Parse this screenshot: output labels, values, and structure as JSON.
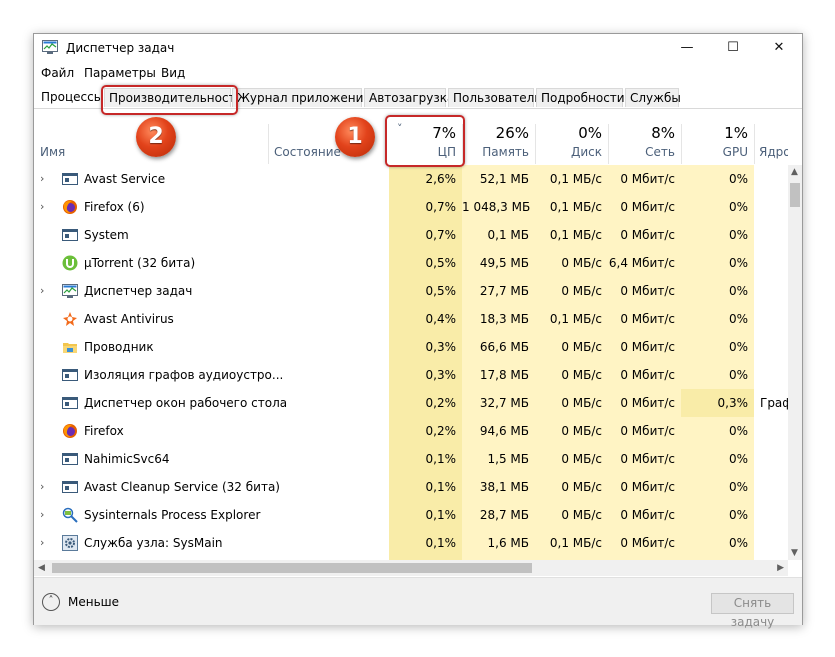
{
  "window": {
    "title": "Диспетчер задач",
    "controls": {
      "minimize": "—",
      "maximize": "☐",
      "close": "✕"
    }
  },
  "menu": {
    "file": "Файл",
    "params": "Параметры",
    "view": "Вид"
  },
  "tabs": [
    "Процессы",
    "Производительность",
    "Журнал приложений",
    "Автозагрузка",
    "Пользователи",
    "Подробности",
    "Службы"
  ],
  "columns": {
    "name": "Имя",
    "status": "Состояние",
    "cpu": {
      "label": "ЦП",
      "total": "7%"
    },
    "memory": {
      "label": "Память",
      "total": "26%"
    },
    "disk": {
      "label": "Диск",
      "total": "0%"
    },
    "network": {
      "label": "Сеть",
      "total": "8%"
    },
    "gpu": {
      "label": "GPU",
      "total": "1%"
    },
    "gpu_engine": {
      "label": "Ядро GP"
    }
  },
  "rows": [
    {
      "name": "Avast Service",
      "icon": "service-window-icon",
      "expandable": true,
      "cpu": "2,6%",
      "memory": "52,1 МБ",
      "disk": "0,1 МБ/с",
      "network": "0 Мбит/с",
      "gpu": "0%",
      "gpu_engine": ""
    },
    {
      "name": "Firefox (6)",
      "icon": "firefox-icon",
      "expandable": true,
      "cpu": "0,7%",
      "memory": "1 048,3 МБ",
      "disk": "0,1 МБ/с",
      "network": "0 Мбит/с",
      "gpu": "0%",
      "gpu_engine": ""
    },
    {
      "name": "System",
      "icon": "service-window-icon",
      "expandable": false,
      "cpu": "0,7%",
      "memory": "0,1 МБ",
      "disk": "0,1 МБ/с",
      "network": "0 Мбит/с",
      "gpu": "0%",
      "gpu_engine": ""
    },
    {
      "name": "µTorrent (32 бита)",
      "icon": "utorrent-icon",
      "expandable": false,
      "cpu": "0,5%",
      "memory": "49,5 МБ",
      "disk": "0 МБ/с",
      "network": "6,4 Мбит/с",
      "gpu": "0%",
      "gpu_engine": ""
    },
    {
      "name": "Диспетчер задач",
      "icon": "task-manager-icon",
      "expandable": true,
      "cpu": "0,5%",
      "memory": "27,7 МБ",
      "disk": "0 МБ/с",
      "network": "0 Мбит/с",
      "gpu": "0%",
      "gpu_engine": ""
    },
    {
      "name": "Avast Antivirus",
      "icon": "avast-icon",
      "expandable": false,
      "cpu": "0,4%",
      "memory": "18,3 МБ",
      "disk": "0,1 МБ/с",
      "network": "0 Мбит/с",
      "gpu": "0%",
      "gpu_engine": ""
    },
    {
      "name": "Проводник",
      "icon": "explorer-folder-icon",
      "expandable": false,
      "cpu": "0,3%",
      "memory": "66,6 МБ",
      "disk": "0 МБ/с",
      "network": "0 Мбит/с",
      "gpu": "0%",
      "gpu_engine": ""
    },
    {
      "name": "Изоляция графов аудиоустро...",
      "icon": "service-window-icon",
      "expandable": false,
      "cpu": "0,3%",
      "memory": "17,8 МБ",
      "disk": "0 МБ/с",
      "network": "0 Мбит/с",
      "gpu": "0%",
      "gpu_engine": ""
    },
    {
      "name": "Диспетчер окон рабочего стола",
      "icon": "service-window-icon",
      "expandable": false,
      "cpu": "0,2%",
      "memory": "32,7 МБ",
      "disk": "0 МБ/с",
      "network": "0 Мбит/с",
      "gpu": "0,3%",
      "gpu_engine": "Граф"
    },
    {
      "name": "Firefox",
      "icon": "firefox-icon",
      "expandable": false,
      "cpu": "0,2%",
      "memory": "94,6 МБ",
      "disk": "0 МБ/с",
      "network": "0 Мбит/с",
      "gpu": "0%",
      "gpu_engine": ""
    },
    {
      "name": "NahimicSvc64",
      "icon": "service-window-icon",
      "expandable": false,
      "cpu": "0,1%",
      "memory": "1,5 МБ",
      "disk": "0 МБ/с",
      "network": "0 Мбит/с",
      "gpu": "0%",
      "gpu_engine": ""
    },
    {
      "name": "Avast Cleanup Service (32 бита)",
      "icon": "service-window-icon",
      "expandable": true,
      "cpu": "0,1%",
      "memory": "38,1 МБ",
      "disk": "0 МБ/с",
      "network": "0 Мбит/с",
      "gpu": "0%",
      "gpu_engine": ""
    },
    {
      "name": "Sysinternals Process Explorer",
      "icon": "process-explorer-icon",
      "expandable": true,
      "cpu": "0,1%",
      "memory": "28,7 МБ",
      "disk": "0 МБ/с",
      "network": "0 Мбит/с",
      "gpu": "0%",
      "gpu_engine": ""
    },
    {
      "name": "Служба узла: SysMain",
      "icon": "gear-icon",
      "expandable": true,
      "cpu": "0,1%",
      "memory": "1,6 МБ",
      "disk": "0,1 МБ/с",
      "network": "0 Мбит/с",
      "gpu": "0%",
      "gpu_engine": ""
    }
  ],
  "annotations": {
    "callout_1": "1",
    "callout_2": "2"
  },
  "footer": {
    "less": "Меньше",
    "end_task": "Снять задачу"
  },
  "colors": {
    "heat_light": "#fff4c4",
    "heat_medium": "#f9eca8",
    "callout_red": "#e2431b",
    "header_text": "#4c607a"
  }
}
